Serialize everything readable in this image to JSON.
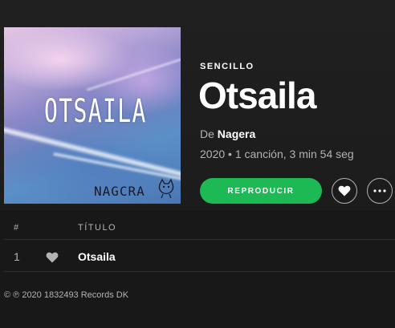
{
  "album": {
    "type_label": "SENCILLO",
    "title": "Otsaila",
    "cover_title": "OTSAILA",
    "cover_brand": "NAGCRA",
    "artist_prefix": "De",
    "artist": "Nagera",
    "meta": "2020 • 1 canción, 3 min 54 seg"
  },
  "actions": {
    "play_label": "REPRODUCIR",
    "like_icon": "heart-icon",
    "more_icon": "ellipsis-icon"
  },
  "tracklist": {
    "headers": {
      "number": "#",
      "title": "TÍTULO"
    },
    "tracks": [
      {
        "number": "1",
        "title": "Otsaila",
        "liked": true
      }
    ]
  },
  "footer": {
    "copyright": "© ℗ 2020 1832493 Records DK"
  },
  "colors": {
    "background": "#181818",
    "accent_green": "#1db954",
    "secondary_text": "#b3b3b3"
  }
}
